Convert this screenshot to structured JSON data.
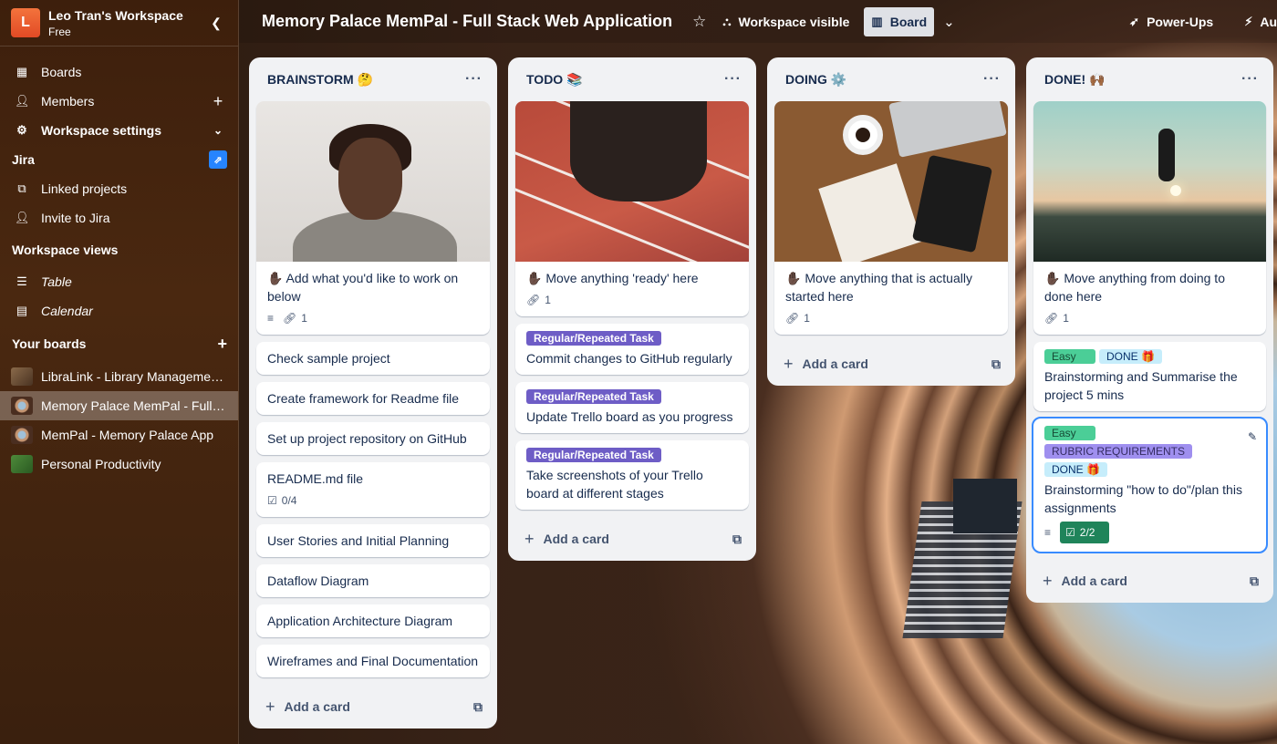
{
  "sidebar": {
    "workspace_initial": "L",
    "workspace_name": "Leo Tran's Workspace",
    "workspace_plan": "Free",
    "nav": [
      {
        "label": "Boards"
      },
      {
        "label": "Members"
      },
      {
        "label": "Workspace settings"
      }
    ],
    "jira_title": "Jira",
    "jira_items": [
      {
        "label": "Linked projects"
      },
      {
        "label": "Invite to Jira"
      }
    ],
    "views_title": "Workspace views",
    "views": [
      {
        "label": "Table"
      },
      {
        "label": "Calendar"
      }
    ],
    "boards_title": "Your boards",
    "boards": [
      {
        "label": "LibraLink - Library Management System"
      },
      {
        "label": "Memory Palace MemPal - Full Stack Web Application"
      },
      {
        "label": "MemPal - Memory Palace App"
      },
      {
        "label": "Personal Productivity"
      }
    ]
  },
  "header": {
    "board_title": "Memory Palace MemPal - Full Stack Web Application",
    "visibility": "Workspace visible",
    "view": "Board",
    "powerups": "Power-Ups",
    "automation": "Au"
  },
  "lists": [
    {
      "title": "BRAINSTORM 🤔",
      "cover_card": {
        "text": "✋🏿 Add what you'd like to work on below",
        "attachments": "1"
      },
      "cards": [
        {
          "text": "Check sample project"
        },
        {
          "text": "Create framework for Readme file"
        },
        {
          "text": "Set up project repository on GitHub"
        },
        {
          "text": "README.md file",
          "checklist": "0/4"
        },
        {
          "text": "User Stories and Initial Planning"
        },
        {
          "text": "Dataflow Diagram"
        },
        {
          "text": "Application Architecture Diagram"
        },
        {
          "text": "Wireframes and Final Documentation"
        }
      ],
      "add_card": "Add a card"
    },
    {
      "title": "TODO 📚",
      "cover_card": {
        "text": "✋🏿 Move anything 'ready' here",
        "attachments": "1"
      },
      "cards": [
        {
          "label": "Regular/Repeated Task",
          "text": "Commit changes to GitHub regularly"
        },
        {
          "label": "Regular/Repeated Task",
          "text": "Update Trello board as you progress"
        },
        {
          "label": "Regular/Repeated Task",
          "text": "Take screenshots of your Trello board at different stages"
        }
      ],
      "add_card": "Add a card"
    },
    {
      "title": "DOING ⚙️",
      "cover_card": {
        "text": "✋🏿 Move anything that is actually started here",
        "attachments": "1"
      },
      "add_card": "Add a card"
    },
    {
      "title": "DONE! 🙌🏾",
      "cover_card": {
        "text": "✋🏿 Move anything from doing to done here",
        "attachments": "1"
      },
      "cards": [
        {
          "labels": [
            "Easy",
            "DONE 🎁"
          ],
          "text": "Brainstorming and Summarise the project 5 mins"
        },
        {
          "labels": [
            "Easy",
            "RUBRIC REQUIREMENTS",
            "DONE 🎁"
          ],
          "text": "Brainstorming \"how to do\"/plan this assignments",
          "checklist": "2/2"
        }
      ],
      "add_card": "Add a card"
    }
  ],
  "colors": {
    "label_purple": "#6e5dc6",
    "label_green": "#4bce97",
    "label_lightblue": "#c6edfb",
    "label_lavender": "#9f8fef",
    "checklist_done": "#1f845a",
    "selection": "#388bff"
  }
}
